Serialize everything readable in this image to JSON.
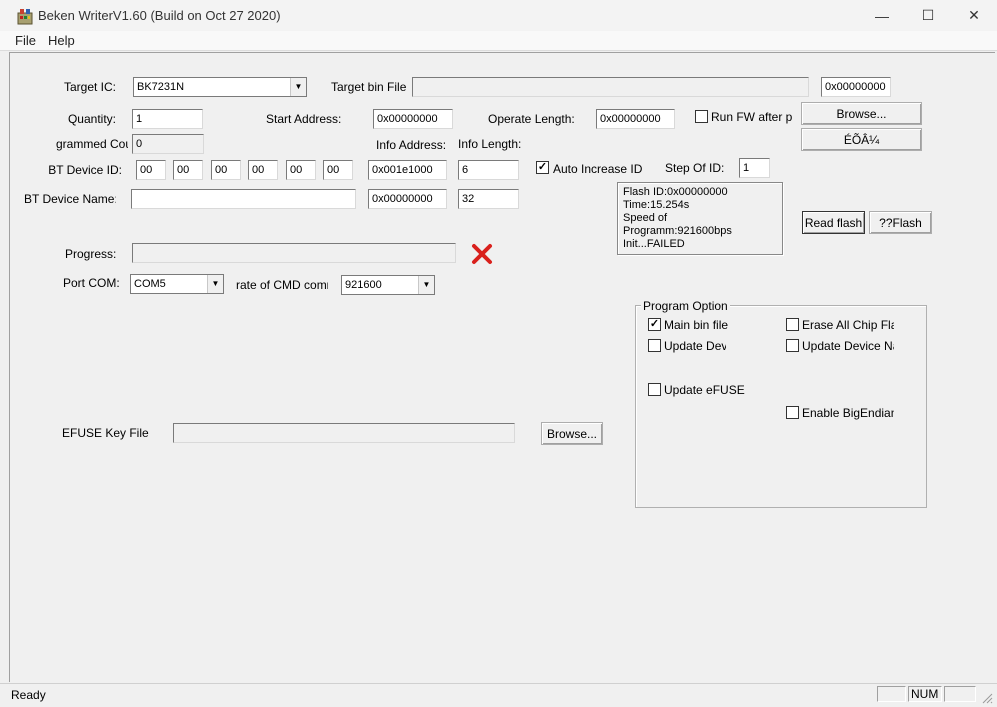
{
  "window": {
    "title": "Beken WriterV1.60 (Build on Oct 27 2020)"
  },
  "titlebar": {
    "minimize": "—",
    "maximize": "☐",
    "close": "✕"
  },
  "menu": {
    "file": "File",
    "help": "Help"
  },
  "form": {
    "target_ic_label": "Target IC:",
    "target_ic_value": "BK7231N",
    "target_bin_label": "Target bin File",
    "target_bin_value": "",
    "target_bin_addr": "0x00000000",
    "quantity_label": "Quantity:",
    "quantity_value": "1",
    "start_address_label": "Start Address:",
    "start_address_value": "0x00000000",
    "operate_length_label": "Operate Length:",
    "operate_length_value": "0x00000000",
    "run_fw_label": "Run FW after pr",
    "run_fw_checked": false,
    "browse_label": "Browse...",
    "garbled_button_label": "ÉÕÂ¼",
    "programmed_count_label": "grammed Cour",
    "programmed_count_value": "0",
    "info_address_label": "Info Address:",
    "info_length_label": "Info Length:",
    "bt_device_id_label": "BT Device ID:",
    "bt_id_bytes": [
      "00",
      "00",
      "00",
      "00",
      "00",
      "00"
    ],
    "info_address_value": "0x001e1000",
    "info_length_value": "6",
    "auto_increase_label": "Auto Increase ID",
    "auto_increase_checked": true,
    "step_of_id_label": "Step Of ID:",
    "step_of_id_value": "1",
    "bt_device_name_label": "BT Device Name:",
    "bt_device_name_value": "",
    "name_address_value": "0x00000000",
    "name_length_value": "32",
    "read_flash_label": "Read flash",
    "flash_label": "??Flash",
    "progress_label": "Progress:",
    "progress_value": 0,
    "port_com_label": "Port COM:",
    "port_com_value": "COM5",
    "baud_label": "rate of CMD comm.",
    "baud_value": "921600",
    "efuse_label": "EFUSE Key File",
    "efuse_value": "",
    "efuse_browse_label": "Browse..."
  },
  "status_box": {
    "line1": "Flash ID:0x00000000",
    "line2": "Time:15.254s",
    "line3": "Speed of Programm:921600bps",
    "line4": "Init...FAILED"
  },
  "program_option": {
    "title": "Program Option",
    "main_bin": {
      "label": "Main bin file",
      "checked": true
    },
    "erase_all": {
      "label": "Erase All Chip Flash",
      "checked": false
    },
    "update_device": {
      "label": "Update Devi",
      "checked": false
    },
    "update_device_name": {
      "label": "Update Device Nam",
      "checked": false
    },
    "update_efuse": {
      "label": "Update eFUSE",
      "checked": false
    },
    "enable_bigendian": {
      "label": "Enable BigEndian II",
      "checked": false
    }
  },
  "statusbar": {
    "text": "Ready",
    "num": "NUM"
  },
  "colors": {
    "error_x": "#d9201c"
  }
}
